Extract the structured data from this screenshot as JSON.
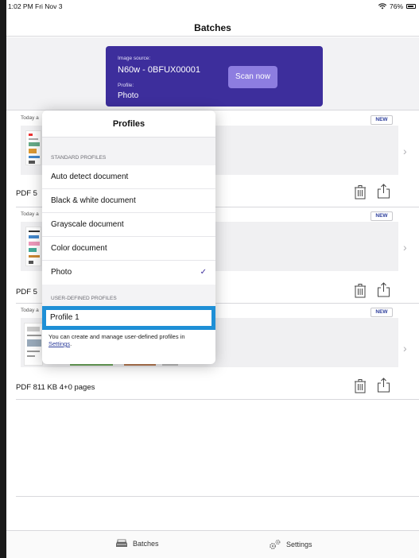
{
  "status_bar": {
    "time_date": "1:02 PM  Fri Nov 3",
    "battery": "76%"
  },
  "nav": {
    "title": "Batches"
  },
  "scanner_card": {
    "source_label": "Image source:",
    "source_value": "N60w - 0BFUX00001",
    "profile_label": "Profile:",
    "profile_value": "Photo",
    "scan_button": "Scan now"
  },
  "batches": [
    {
      "date": "Today a",
      "badge": "NEW",
      "info": "PDF 5"
    },
    {
      "date": "Today a",
      "badge": "NEW",
      "info": "PDF 5"
    },
    {
      "date": "Today a",
      "badge": "NEW",
      "info": "PDF 811 KB  4+0 pages"
    }
  ],
  "profiles_popover": {
    "title": "Profiles",
    "standard_header": "STANDARD PROFILES",
    "standard_items": [
      "Auto detect document",
      "Black & white document",
      "Grayscale document",
      "Color document",
      "Photo"
    ],
    "selected_item": "Photo",
    "user_header": "USER-DEFINED PROFILES",
    "user_item": "Profile 1",
    "note_text": "You can create and manage user-defined profiles in",
    "note_link": "Settings",
    "note_end": "."
  },
  "tab_bar": {
    "batches_label": "Batches",
    "settings_label": "Settings"
  },
  "colors": {
    "accent": "#3d2e9c",
    "scan_button": "#8d7de0",
    "highlight": "#1e8fd6"
  }
}
